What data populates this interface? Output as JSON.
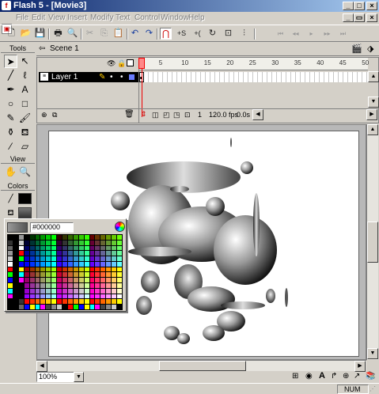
{
  "window": {
    "title": "Flash 5 - [Movie3]",
    "controls": [
      "_",
      "□",
      "×"
    ],
    "doc_controls": [
      "_",
      "▭",
      "×"
    ]
  },
  "menu": [
    "File",
    "Edit",
    "View",
    "Insert",
    "Modify",
    "Text",
    "Control",
    "Window",
    "Help"
  ],
  "toolbar": [
    {
      "name": "new-icon",
      "glyph": "🗋"
    },
    {
      "name": "open-icon",
      "glyph": "📂"
    },
    {
      "name": "save-icon",
      "glyph": "💾"
    },
    {
      "name": "print-icon",
      "glyph": "🖶"
    },
    {
      "name": "print-preview-icon",
      "glyph": "🔍"
    },
    {
      "name": "cut-icon",
      "glyph": "✂"
    },
    {
      "name": "copy-icon",
      "glyph": "⎘"
    },
    {
      "name": "paste-icon",
      "glyph": "📋"
    },
    {
      "name": "undo-icon",
      "glyph": "↶"
    },
    {
      "name": "redo-icon",
      "glyph": "↷"
    },
    {
      "name": "snap-magnet-icon",
      "glyph": "⋂"
    },
    {
      "name": "smooth-icon",
      "glyph": "+S"
    },
    {
      "name": "straighten-icon",
      "glyph": "+("
    },
    {
      "name": "rotate-icon",
      "glyph": "↻"
    },
    {
      "name": "scale-icon",
      "glyph": "⊡"
    },
    {
      "name": "align-icon",
      "glyph": "⫶"
    },
    {
      "name": "control-rewind-icon",
      "glyph": "⏮"
    },
    {
      "name": "control-back-icon",
      "glyph": "◂◂"
    },
    {
      "name": "control-play-icon",
      "glyph": "▸"
    },
    {
      "name": "control-forward-icon",
      "glyph": "▸▸"
    },
    {
      "name": "control-end-icon",
      "glyph": "⏭"
    }
  ],
  "tools_panel": {
    "tools_label": "Tools",
    "view_label": "View",
    "colors_label": "Colors",
    "tools": [
      {
        "name": "arrow-tool-icon",
        "glyph": "➤"
      },
      {
        "name": "subselect-tool-icon",
        "glyph": "↖"
      },
      {
        "name": "line-tool-icon",
        "glyph": "╱"
      },
      {
        "name": "lasso-tool-icon",
        "glyph": "ℓ"
      },
      {
        "name": "pen-tool-icon",
        "glyph": "✒"
      },
      {
        "name": "text-tool-icon",
        "glyph": "A"
      },
      {
        "name": "oval-tool-icon",
        "glyph": "○"
      },
      {
        "name": "rectangle-tool-icon",
        "glyph": "□"
      },
      {
        "name": "pencil-tool-icon",
        "glyph": "✎"
      },
      {
        "name": "brush-tool-icon",
        "glyph": "🖌"
      },
      {
        "name": "ink-bottle-tool-icon",
        "glyph": "⚱"
      },
      {
        "name": "paint-bucket-tool-icon",
        "glyph": "⛾"
      },
      {
        "name": "dropper-tool-icon",
        "glyph": "⁄"
      },
      {
        "name": "eraser-tool-icon",
        "glyph": "▱"
      }
    ],
    "view_tools": [
      {
        "name": "hand-tool-icon",
        "glyph": "✋"
      },
      {
        "name": "zoom-tool-icon",
        "glyph": "🔍"
      }
    ],
    "stroke_icon": "pencil-stroke-icon",
    "fill_icon": "bucket-fill-icon"
  },
  "scene": {
    "label": "Scene 1"
  },
  "timeline": {
    "ruler": [
      "1",
      "5",
      "10",
      "15",
      "20",
      "25",
      "30",
      "35",
      "40",
      "45",
      "50"
    ],
    "layer_name": "Layer 1",
    "current_frame": "1",
    "frame_rate": "120.0 fps",
    "elapsed": "0.0s"
  },
  "color_palette": {
    "hex_value": "#000000"
  },
  "status": {
    "zoom": "100%",
    "num": "NUM"
  },
  "colors": {
    "titlebar": "#0a246a",
    "face": "#d4d0c8",
    "playhead": "#e00000",
    "layer_selected": "#000000"
  }
}
